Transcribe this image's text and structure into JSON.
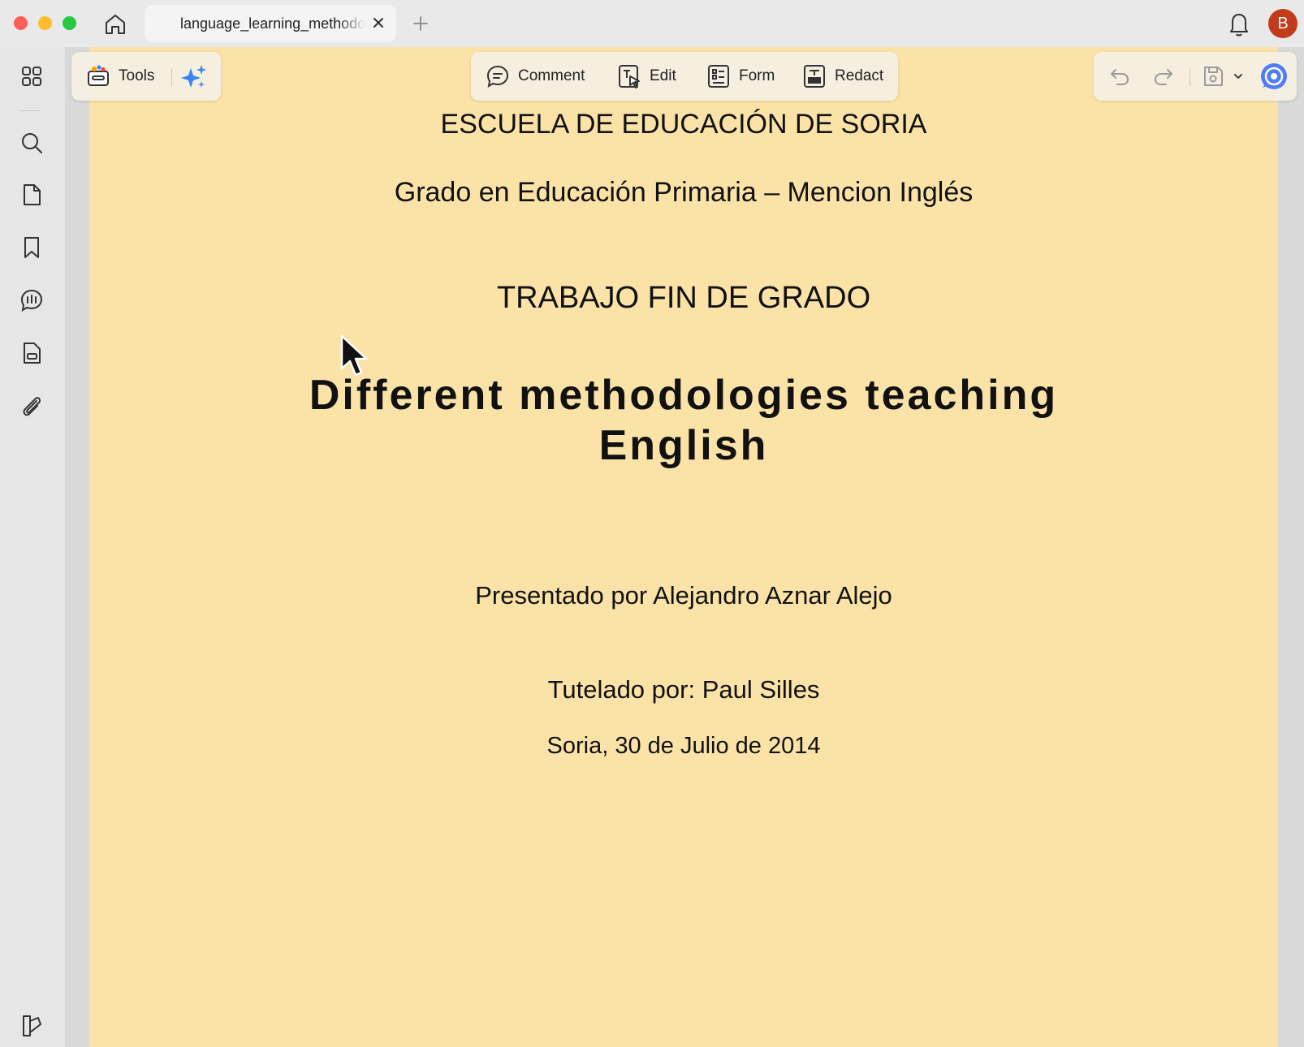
{
  "window": {
    "tab_title": "language_learning_methodologies.pdf",
    "avatar_letter": "B",
    "icons": [
      "home-icon",
      "close-icon",
      "plus-icon",
      "bell-icon"
    ]
  },
  "sidebar": {
    "icons": [
      "grid-icon",
      "search-icon",
      "page-icon",
      "bookmark-icon",
      "comment-panel-icon",
      "form-icon",
      "attachment-icon",
      "panel-toggle-icon"
    ]
  },
  "toolbar": {
    "tools_label": "Tools",
    "comment_label": "Comment",
    "edit_label": "Edit",
    "form_label": "Form",
    "redact_label": "Redact",
    "icons": [
      "tools-icon",
      "ai-sparkle-icon",
      "undo-icon",
      "redo-icon",
      "save-icon",
      "chevron-down-icon",
      "assistant-icon"
    ]
  },
  "document": {
    "school": "ESCUELA DE EDUCACIÓN DE SORIA",
    "degree": "Grado en Educación Primaria – Mencion Inglés",
    "work_type": "TRABAJO FIN DE GRADO",
    "title_line1": "Different methodologies teaching",
    "title_line2": "English",
    "presented_by": "Presentado por Alejandro Aznar Alejo",
    "tutor": "Tutelado por: Paul Silles",
    "place_date": "Soria, 30 de Julio de 2014"
  },
  "colors": {
    "page_background": "#fbe3a8",
    "avatar": "#c23b1b",
    "accent_blue": "#3b82f6"
  }
}
